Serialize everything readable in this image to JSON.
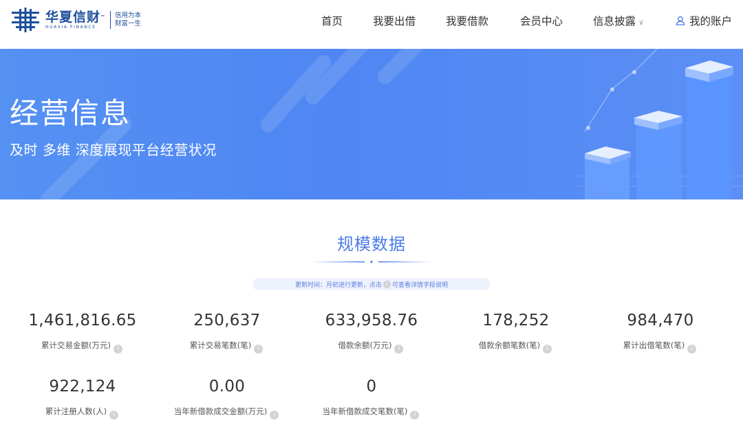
{
  "header": {
    "logo": {
      "name_cn": "华夏信财",
      "name_en": "HUAXIA FINANCE",
      "trademark": "™",
      "slogan_line1": "信用为本",
      "slogan_line2": "财富一生"
    },
    "nav": [
      {
        "label": "首页"
      },
      {
        "label": "我要出借"
      },
      {
        "label": "我要借款"
      },
      {
        "label": "会员中心"
      },
      {
        "label": "信息披露",
        "has_dropdown": true,
        "chevron": "∨"
      }
    ],
    "account_label": "我的账户",
    "account_icon": "user-icon"
  },
  "banner": {
    "title": "经营信息",
    "subtitle": "及时 多维 深度展现平台经营状况"
  },
  "section": {
    "title": "规模数据",
    "update_prefix": "更新时间：月初进行更新，点击",
    "update_suffix": "可查看详情字段说明",
    "info_glyph": "i"
  },
  "stats": [
    {
      "value": "1,461,816.65",
      "label": "累计交易金额(万元)"
    },
    {
      "value": "250,637",
      "label": "累计交易笔数(笔)"
    },
    {
      "value": "633,958.76",
      "label": "借款余额(万元)"
    },
    {
      "value": "178,252",
      "label": "借款余额笔数(笔)"
    },
    {
      "value": "984,470",
      "label": "累计出借笔数(笔)"
    },
    {
      "value": "922,124",
      "label": "累计注册人数(人)"
    },
    {
      "value": "0.00",
      "label": "当年新借款成交金额(万元)"
    },
    {
      "value": "0",
      "label": "当年新借款成交笔数(笔)"
    }
  ],
  "colors": {
    "brand": "#1d4e9c",
    "accent": "#4a7bea",
    "banner": "#5591f3"
  }
}
